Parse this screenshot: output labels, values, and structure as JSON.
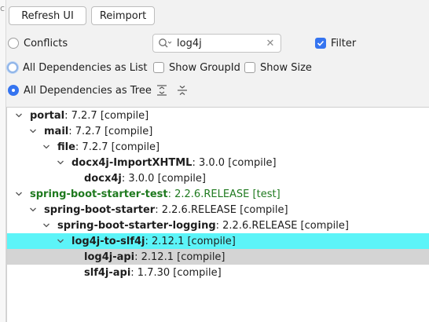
{
  "toolbar": {
    "refresh_label": "Refresh UI",
    "reimport_label": "Reimport"
  },
  "left_stub_char": "c",
  "options": {
    "conflicts_label": "Conflicts",
    "list_label": "All Dependencies as List",
    "tree_label": "All Dependencies as Tree",
    "selected_view": "tree"
  },
  "search": {
    "value": "log4j",
    "placeholder": ""
  },
  "filter": {
    "label": "Filter",
    "checked": true
  },
  "show_group_id": {
    "label": "Show GroupId",
    "checked": false
  },
  "show_size": {
    "label": "Show Size",
    "checked": false
  },
  "tree": {
    "rows": [
      {
        "name": "portal",
        "detail": " : 7.2.7 [compile]",
        "expanded": true,
        "test": false
      },
      {
        "name": "mail",
        "detail": " : 7.2.7 [compile]",
        "expanded": true,
        "test": false
      },
      {
        "name": "file",
        "detail": " : 7.2.7 [compile]",
        "expanded": true,
        "test": false
      },
      {
        "name": "docx4j-ImportXHTML",
        "detail": " : 3.0.0 [compile]",
        "expanded": true,
        "test": false
      },
      {
        "name": "docx4j",
        "detail": " : 3.0.0 [compile]",
        "expanded": null,
        "test": false
      },
      {
        "name": "spring-boot-starter-test",
        "detail": " : 2.2.6.RELEASE [test]",
        "expanded": true,
        "test": true
      },
      {
        "name": "spring-boot-starter",
        "detail": " : 2.2.6.RELEASE [compile]",
        "expanded": true,
        "test": false
      },
      {
        "name": "spring-boot-starter-logging",
        "detail": " : 2.2.6.RELEASE [compile]",
        "expanded": true,
        "test": false
      },
      {
        "name": "log4j-to-slf4j",
        "detail": " : 2.12.1 [compile]",
        "expanded": true,
        "test": false
      },
      {
        "name": "log4j-api",
        "detail": " : 2.12.1 [compile]",
        "expanded": null,
        "test": false
      },
      {
        "name": "slf4j-api",
        "detail": " : 1.7.30 [compile]",
        "expanded": null,
        "test": false
      }
    ],
    "selected_row": "log4j-to-slf4j",
    "hover_row": "log4j-api"
  },
  "colors": {
    "selection": "#5cf4f8",
    "hover": "#d4d4d4",
    "test_scope": "#1f7a1f",
    "accent": "#3574f0"
  }
}
